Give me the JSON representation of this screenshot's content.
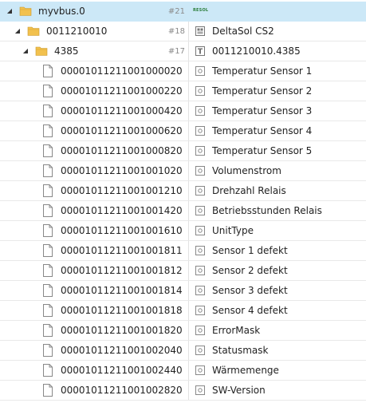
{
  "tree": {
    "root": {
      "name": "myvbus.0",
      "count": "#21",
      "logo_text": "RESOL"
    },
    "device": {
      "name": "0011210010",
      "count": "#18",
      "label": "DeltaSol CS2"
    },
    "channel": {
      "name": "4385",
      "count": "#17",
      "label": "0011210010.4385"
    },
    "states": [
      {
        "id": "00001011211001000020",
        "label": "Temperatur Sensor 1"
      },
      {
        "id": "00001011211001000220",
        "label": "Temperatur Sensor 2"
      },
      {
        "id": "00001011211001000420",
        "label": "Temperatur Sensor 3"
      },
      {
        "id": "00001011211001000620",
        "label": "Temperatur Sensor 4"
      },
      {
        "id": "00001011211001000820",
        "label": "Temperatur Sensor 5"
      },
      {
        "id": "00001011211001001020",
        "label": "Volumenstrom"
      },
      {
        "id": "00001011211001001210",
        "label": "Drehzahl Relais"
      },
      {
        "id": "00001011211001001420",
        "label": "Betriebsstunden Relais"
      },
      {
        "id": "00001011211001001610",
        "label": "UnitType"
      },
      {
        "id": "00001011211001001811",
        "label": "Sensor 1 defekt"
      },
      {
        "id": "00001011211001001812",
        "label": "Sensor 2 defekt"
      },
      {
        "id": "00001011211001001814",
        "label": "Sensor 3 defekt"
      },
      {
        "id": "00001011211001001818",
        "label": "Sensor 4 defekt"
      },
      {
        "id": "00001011211001001820",
        "label": "ErrorMask"
      },
      {
        "id": "00001011211001002040",
        "label": "Statusmask"
      },
      {
        "id": "00001011211001002440",
        "label": "Wärmemenge"
      },
      {
        "id": "00001011211001002820",
        "label": "SW-Version"
      }
    ]
  },
  "icons": {
    "expanded": "triangle-down-icon",
    "folder": "folder-icon",
    "file": "file-icon",
    "device": "device-icon",
    "channel": "channel-icon",
    "state": "state-icon"
  },
  "colors": {
    "selected_row": "#cce8f7",
    "folder": "#f2c14e",
    "logo": "#2a7d3a",
    "count_text": "#8a8a8a"
  }
}
